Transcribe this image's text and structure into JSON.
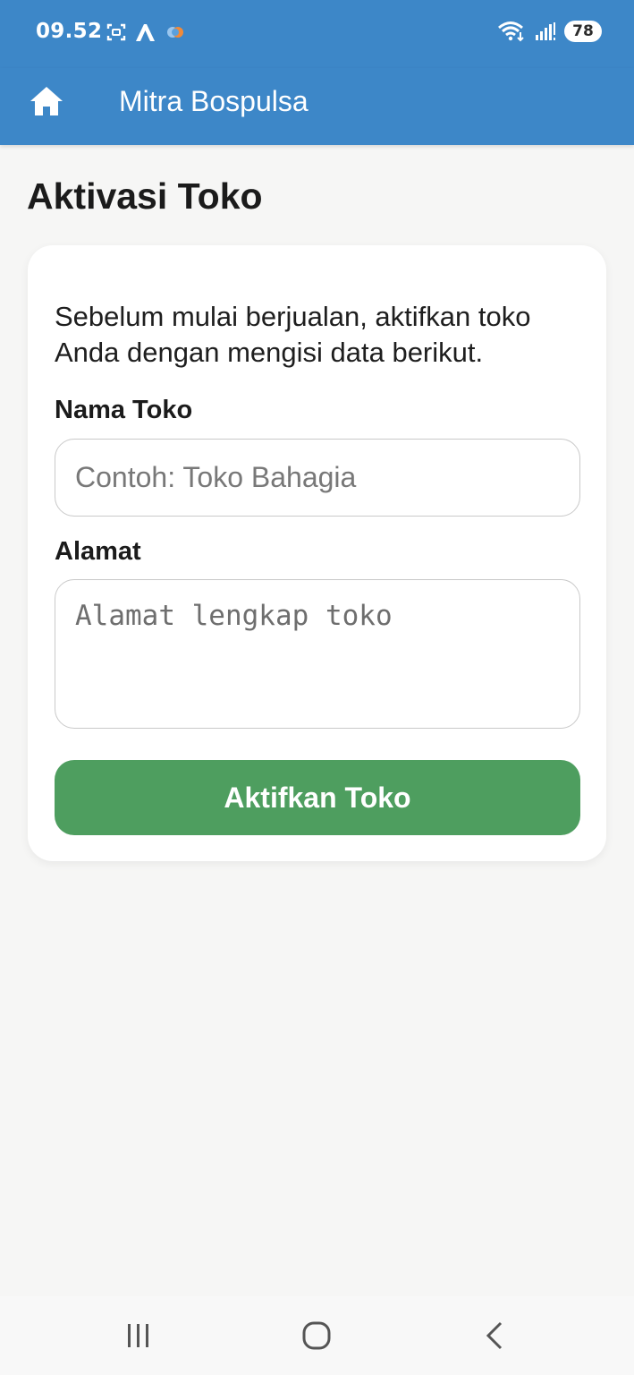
{
  "status_bar": {
    "time": "09.52",
    "battery": "78",
    "left_icons": [
      "screenshot-icon",
      "app-logo-icon",
      "cloud-icon"
    ],
    "right_icons": [
      "wifi-icon",
      "signal-icon"
    ]
  },
  "app_bar": {
    "title": "Mitra Bospulsa",
    "home_icon": "home-icon",
    "background": "#3d87c8"
  },
  "page": {
    "title": "Aktivasi Toko"
  },
  "form": {
    "intro": "Sebelum mulai berjualan, aktifkan toko Anda dengan mengisi data berikut.",
    "nama_label": "Nama Toko",
    "nama_placeholder": "Contoh: Toko Bahagia",
    "nama_value": "",
    "alamat_label": "Alamat",
    "alamat_placeholder": "Alamat lengkap toko",
    "alamat_value": "",
    "submit_label": "Aktifkan Toko",
    "submit_color": "#4e9e5f"
  },
  "nav_bar": {
    "buttons": [
      "recent-apps-icon",
      "home-circle-icon",
      "back-icon"
    ]
  }
}
